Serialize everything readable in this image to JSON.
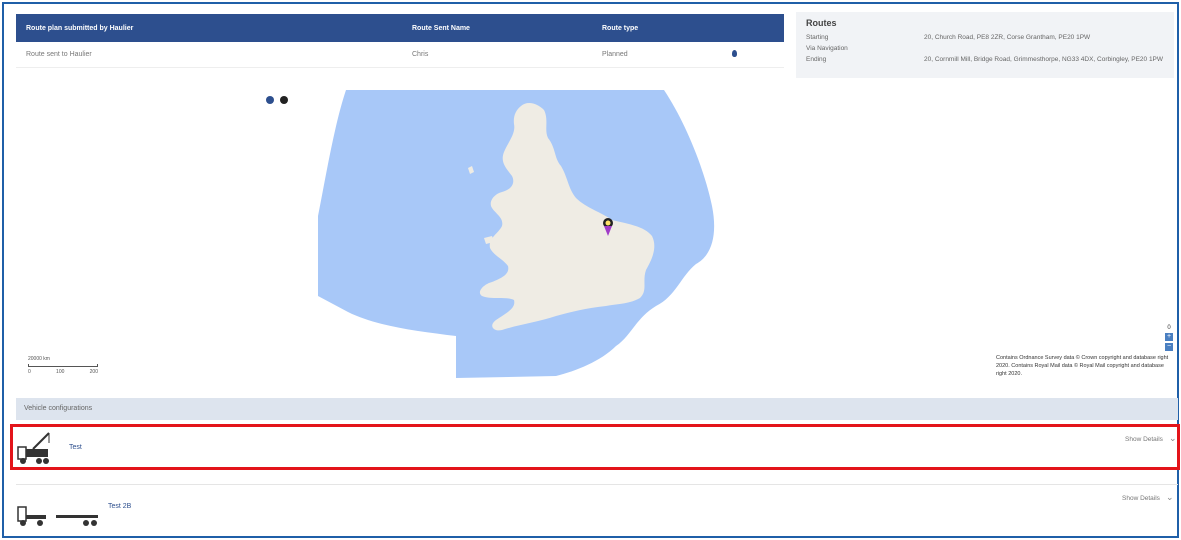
{
  "route_table": {
    "headers": [
      "Route plan submitted by Haulier",
      "Route Sent Name",
      "Route type",
      ""
    ],
    "rows": [
      {
        "plan": "Route sent to Haulier",
        "sent_name": "Chris",
        "type": "Planned"
      }
    ]
  },
  "routes": {
    "title": "Routes",
    "rows": [
      {
        "label": "Starting",
        "value": "20, Church Road, PE8 2ZR, Corse Grantham, PE20 1PW"
      },
      {
        "label": "Via Navigation",
        "value": ""
      },
      {
        "label": "Ending",
        "value": "20, Cornmill Mill, Bridge Road, Grimmesthorpe, NG33 4DX, Corbingley, PE20 1PW"
      }
    ]
  },
  "map": {
    "sea_color": "#a8c8f8",
    "land_color": "#efece4",
    "scale_label": "20000 km",
    "scale_ticks": [
      "0",
      "100",
      "200"
    ],
    "zoom_in": "+",
    "zoom_out": "−",
    "zoom_level": "0",
    "attribution": "Contains Ordnance Survey data © Crown copyright and database right 2020. Contains Royal Mail data © Royal Mail copyright and database right 2020."
  },
  "vehicle_configurations": {
    "header": "Vehicle configurations",
    "items": [
      {
        "name": "Test",
        "details_label": "Show Details",
        "selected": true
      },
      {
        "name": "Test 2B",
        "details_label": "Show Details",
        "selected": false
      }
    ]
  }
}
